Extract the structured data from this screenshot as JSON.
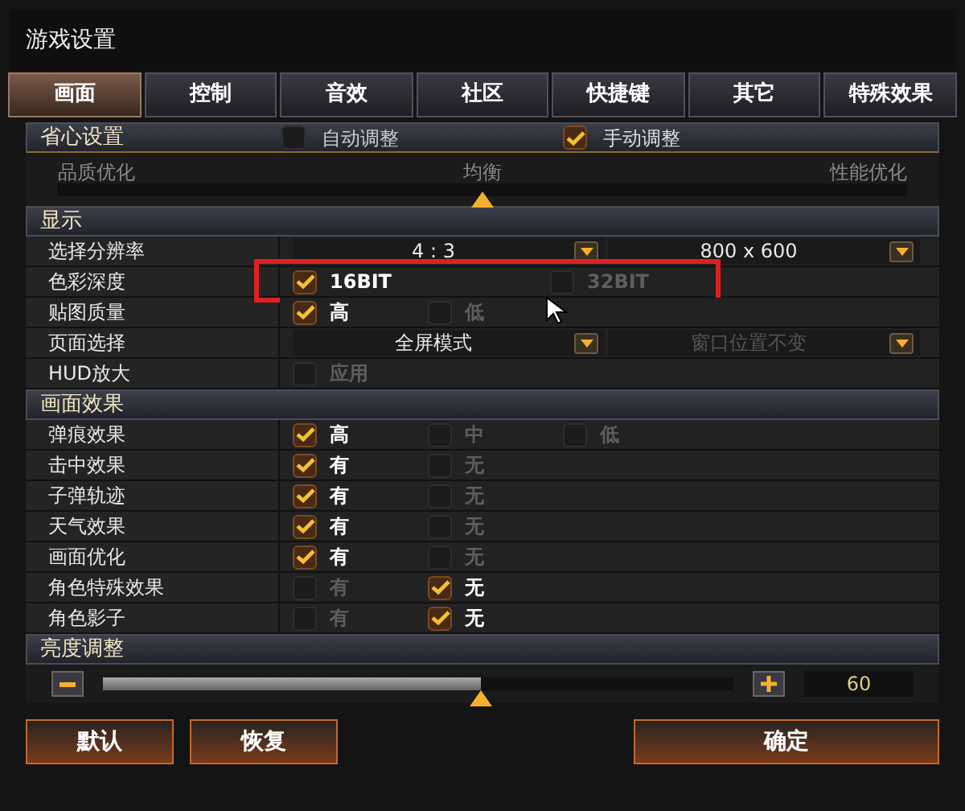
{
  "window": {
    "title": "游戏设置"
  },
  "tabs": [
    {
      "label": "画面",
      "selected": true
    },
    {
      "label": "控制",
      "selected": false
    },
    {
      "label": "音效",
      "selected": false
    },
    {
      "label": "社区",
      "selected": false
    },
    {
      "label": "快捷键",
      "selected": false
    },
    {
      "label": "其它",
      "selected": false
    },
    {
      "label": "特殊效果",
      "selected": false
    }
  ],
  "quick": {
    "title": "省心设置",
    "options": [
      {
        "label": "自动调整",
        "checked": false
      },
      {
        "label": "手动调整",
        "checked": true
      }
    ],
    "scale_labels": [
      "品质优化",
      "均衡",
      "性能优化"
    ],
    "level": 0.5
  },
  "display": {
    "title": "显示",
    "rows": [
      {
        "label": "选择分辨率",
        "kind": "dropdowns",
        "dropdowns": [
          {
            "value": "4 : 3",
            "disabled": false
          },
          {
            "value": "800 x 600",
            "disabled": false
          }
        ]
      },
      {
        "label": "色彩深度",
        "kind": "options",
        "highlighted": true,
        "options": [
          {
            "label": "16BIT",
            "checked": true
          },
          {
            "label": "32BIT",
            "checked": false
          }
        ]
      },
      {
        "label": "贴图质量",
        "kind": "options",
        "highlighted": false,
        "options": [
          {
            "label": "高",
            "checked": true
          },
          {
            "label": "低",
            "checked": false
          }
        ]
      },
      {
        "label": "页面选择",
        "kind": "dropdowns",
        "dropdowns": [
          {
            "value": "全屏模式",
            "disabled": false
          },
          {
            "value": "窗口位置不变",
            "disabled": true
          }
        ]
      },
      {
        "label": "HUD放大",
        "kind": "options",
        "highlighted": false,
        "options": [
          {
            "label": "应用",
            "checked": false
          }
        ]
      }
    ]
  },
  "effects": {
    "title": "画面效果",
    "rows": [
      {
        "label": "弹痕效果",
        "options": [
          {
            "label": "高",
            "checked": true
          },
          {
            "label": "中",
            "checked": false
          },
          {
            "label": "低",
            "checked": false
          }
        ]
      },
      {
        "label": "击中效果",
        "options": [
          {
            "label": "有",
            "checked": true
          },
          {
            "label": "无",
            "checked": false
          }
        ]
      },
      {
        "label": "子弹轨迹",
        "options": [
          {
            "label": "有",
            "checked": true
          },
          {
            "label": "无",
            "checked": false
          }
        ]
      },
      {
        "label": "天气效果",
        "options": [
          {
            "label": "有",
            "checked": true
          },
          {
            "label": "无",
            "checked": false
          }
        ]
      },
      {
        "label": "画面优化",
        "options": [
          {
            "label": "有",
            "checked": true
          },
          {
            "label": "无",
            "checked": false
          }
        ]
      },
      {
        "label": "角色特殊效果",
        "options": [
          {
            "label": "有",
            "checked": false
          },
          {
            "label": "无",
            "checked": true
          }
        ]
      },
      {
        "label": "角色影子",
        "options": [
          {
            "label": "有",
            "checked": false
          },
          {
            "label": "无",
            "checked": true
          }
        ]
      }
    ]
  },
  "brightness": {
    "title": "亮度调整",
    "level": 0.6,
    "reading": "60"
  },
  "footer": {
    "left_buttons": [
      "默认",
      "恢复"
    ],
    "right_buttons": [
      "确定"
    ]
  }
}
